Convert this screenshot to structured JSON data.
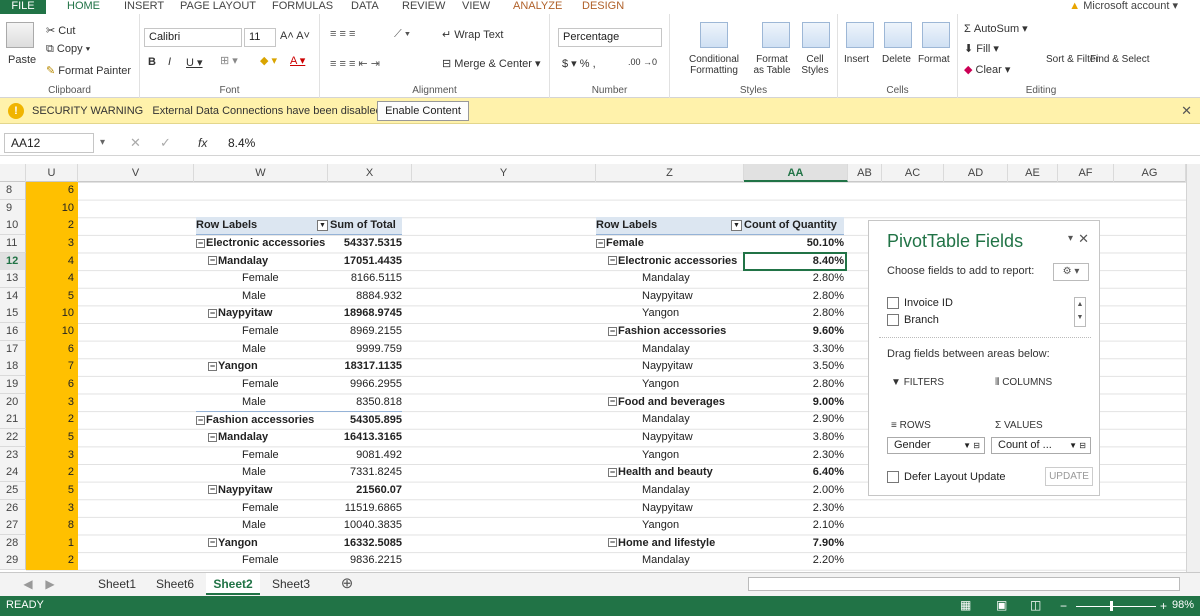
{
  "ribbon_tabs": [
    "FILE",
    "HOME",
    "INSERT",
    "PAGE LAYOUT",
    "FORMULAS",
    "DATA",
    "REVIEW",
    "VIEW",
    "ANALYZE",
    "DESIGN"
  ],
  "account": "Microsoft account",
  "clipboard": {
    "paste": "Paste",
    "cut": "Cut",
    "copy": "Copy",
    "format_painter": "Format Painter",
    "label": "Clipboard"
  },
  "font": {
    "name": "Calibri",
    "size": "11",
    "label": "Font"
  },
  "alignment": {
    "wrap": "Wrap Text",
    "merge": "Merge & Center",
    "label": "Alignment"
  },
  "number": {
    "format": "Percentage",
    "currency": "$",
    "percent": "%",
    "comma": ",",
    "label": "Number"
  },
  "styles": {
    "cond": "Conditional Formatting",
    "table": "Format as Table",
    "cell": "Cell Styles",
    "label": "Styles"
  },
  "cells_grp": {
    "insert": "Insert",
    "delete": "Delete",
    "format": "Format",
    "label": "Cells"
  },
  "editing": {
    "autosum": "AutoSum",
    "fill": "Fill",
    "clear": "Clear",
    "sort": "Sort & Filter",
    "find": "Find & Select",
    "label": "Editing"
  },
  "security": {
    "title": "SECURITY WARNING",
    "message": "External Data Connections have been disabled",
    "button": "Enable Content"
  },
  "formula_bar": {
    "name_box": "AA12",
    "fx": "fx",
    "formula": "8.4%"
  },
  "columns": [
    "U",
    "V",
    "W",
    "X",
    "Y",
    "Z",
    "AA",
    "AB",
    "AC",
    "AD",
    "AE",
    "AF",
    "AG"
  ],
  "rows": [
    "8",
    "9",
    "10",
    "11",
    "12",
    "13",
    "14",
    "15",
    "16",
    "17",
    "18",
    "19",
    "20",
    "21",
    "22",
    "23",
    "24",
    "25",
    "26",
    "27",
    "28",
    "29"
  ],
  "col_u": [
    "6",
    "10",
    "2",
    "3",
    "4",
    "4",
    "5",
    "10",
    "10",
    "6",
    "7",
    "6",
    "3",
    "2",
    "5",
    "3",
    "2",
    "5",
    "3",
    "8",
    "1",
    "2"
  ],
  "pivot1": {
    "hdr_label": "Row Labels",
    "hdr_value": "Sum of Total",
    "rows": [
      {
        "label": "Electronic accessories",
        "value": "54337.5315",
        "lvl": 0
      },
      {
        "label": "Mandalay",
        "value": "17051.4435",
        "lvl": 1
      },
      {
        "label": "Female",
        "value": "8166.5115",
        "lvl": 2
      },
      {
        "label": "Male",
        "value": "8884.932",
        "lvl": 2
      },
      {
        "label": "Naypyitaw",
        "value": "18968.9745",
        "lvl": 1
      },
      {
        "label": "Female",
        "value": "8969.2155",
        "lvl": 2
      },
      {
        "label": "Male",
        "value": "9999.759",
        "lvl": 2
      },
      {
        "label": "Yangon",
        "value": "18317.1135",
        "lvl": 1
      },
      {
        "label": "Female",
        "value": "9966.2955",
        "lvl": 2
      },
      {
        "label": "Male",
        "value": "8350.818",
        "lvl": 2
      },
      {
        "label": "Fashion accessories",
        "value": "54305.895",
        "lvl": 0
      },
      {
        "label": "Mandalay",
        "value": "16413.3165",
        "lvl": 1
      },
      {
        "label": "Female",
        "value": "9081.492",
        "lvl": 2
      },
      {
        "label": "Male",
        "value": "7331.8245",
        "lvl": 2
      },
      {
        "label": "Naypyitaw",
        "value": "21560.07",
        "lvl": 1
      },
      {
        "label": "Female",
        "value": "11519.6865",
        "lvl": 2
      },
      {
        "label": "Male",
        "value": "10040.3835",
        "lvl": 2
      },
      {
        "label": "Yangon",
        "value": "16332.5085",
        "lvl": 1
      },
      {
        "label": "Female",
        "value": "9836.2215",
        "lvl": 2
      }
    ]
  },
  "pivot2": {
    "hdr_label": "Row Labels",
    "hdr_value": "Count of Quantity",
    "rows": [
      {
        "label": "Female",
        "value": "50.10%",
        "lvl": 0
      },
      {
        "label": "Electronic accessories",
        "value": "8.40%",
        "lvl": 1
      },
      {
        "label": "Mandalay",
        "value": "2.80%",
        "lvl": 2
      },
      {
        "label": "Naypyitaw",
        "value": "2.80%",
        "lvl": 2
      },
      {
        "label": "Yangon",
        "value": "2.80%",
        "lvl": 2
      },
      {
        "label": "Fashion accessories",
        "value": "9.60%",
        "lvl": 1
      },
      {
        "label": "Mandalay",
        "value": "3.30%",
        "lvl": 2
      },
      {
        "label": "Naypyitaw",
        "value": "3.50%",
        "lvl": 2
      },
      {
        "label": "Yangon",
        "value": "2.80%",
        "lvl": 2
      },
      {
        "label": "Food and beverages",
        "value": "9.00%",
        "lvl": 1
      },
      {
        "label": "Mandalay",
        "value": "2.90%",
        "lvl": 2
      },
      {
        "label": "Naypyitaw",
        "value": "3.80%",
        "lvl": 2
      },
      {
        "label": "Yangon",
        "value": "2.30%",
        "lvl": 2
      },
      {
        "label": "Health and beauty",
        "value": "6.40%",
        "lvl": 1
      },
      {
        "label": "Mandalay",
        "value": "2.00%",
        "lvl": 2
      },
      {
        "label": "Naypyitaw",
        "value": "2.30%",
        "lvl": 2
      },
      {
        "label": "Yangon",
        "value": "2.10%",
        "lvl": 2
      },
      {
        "label": "Home and lifestyle",
        "value": "7.90%",
        "lvl": 1
      },
      {
        "label": "Mandalay",
        "value": "2.20%",
        "lvl": 2
      }
    ]
  },
  "pivot_pane": {
    "title": "PivotTable Fields",
    "subtitle": "Choose fields to add to report:",
    "fields": [
      "Invoice ID",
      "Branch"
    ],
    "drag_hint": "Drag fields between areas below:",
    "filters": "FILTERS",
    "columns": "COLUMNS",
    "rows": "ROWS",
    "values": "VALUES",
    "rows_value": "Gender",
    "values_value": "Count of ...",
    "defer": "Defer Layout Update",
    "update": "UPDATE"
  },
  "sheets": [
    "Sheet1",
    "Sheet6",
    "Sheet2",
    "Sheet3"
  ],
  "active_sheet": "Sheet2",
  "status": {
    "mode": "READY",
    "zoom": "98%"
  },
  "colors": {
    "excel_green": "#217346",
    "highlight": "#ffc000",
    "pivot_header": "#dce6f1"
  }
}
